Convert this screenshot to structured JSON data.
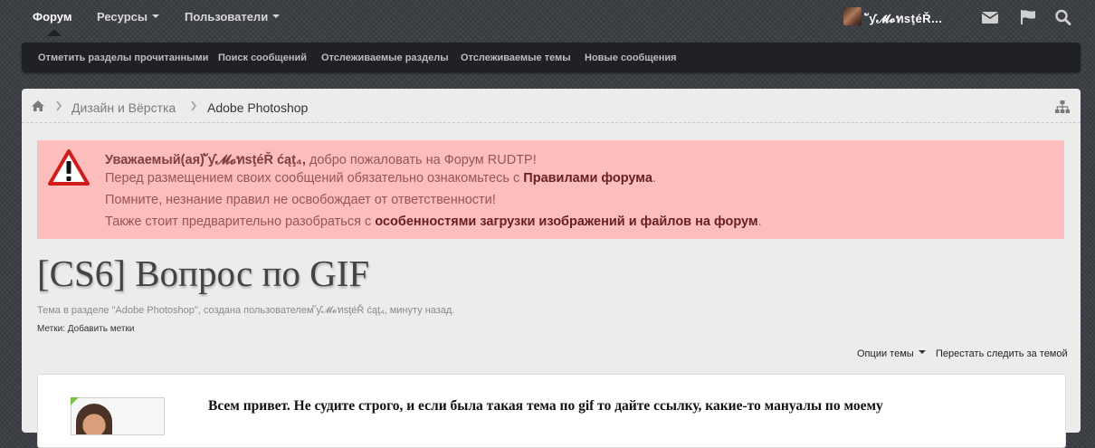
{
  "nav": {
    "tabs": [
      {
        "label": "Форум",
        "active": true
      },
      {
        "label": "Ресурсы",
        "dropdown": true
      },
      {
        "label": "Пользователи",
        "dropdown": true
      }
    ],
    "user_name": "ัƴ𝓜𝓸ทѕţéŘ...",
    "icons": [
      "envelope-icon",
      "flag-icon",
      "search-icon"
    ]
  },
  "subnav": {
    "items": [
      "Отметить разделы прочитанными",
      "Поиск сообщений",
      "Отслеживаемые разделы",
      "Отслеживаемые темы",
      "Новые сообщения"
    ]
  },
  "breadcrumb": {
    "icon": "home-icon",
    "items": [
      "Дизайн и Вёрстка",
      "Adobe Photoshop"
    ]
  },
  "notice": {
    "greeting_prefix": "Уважаемый(ая)",
    "greeting_name": "ัƴ𝓜𝓸ทѕţéŘ ćąţ₄,",
    "greeting_suffix": "добро пожаловать на Форум RUDTP!",
    "line2_prefix": "Перед размещением своих сообщений обязательно ознакомьтесь с",
    "line2_link": "Правилами форума",
    "line2_suffix": ".",
    "line3": "Помните, незнание правил не освобождает от ответственности!",
    "line4_prefix": "Также стоит предварительно разобраться с",
    "line4_link": "особенностями загрузки изображений и файлов на форум",
    "line4_suffix": "."
  },
  "thread": {
    "title": "[CS6] Вопрос по GIF",
    "meta": "Тема в разделе \"Adobe Photoshop\", создана пользователем ัƴ𝓜𝓸ทѕţéŘ ćąţ₄, минуту назад.",
    "tags_label": "Метки:",
    "tags_link": "Добавить метки",
    "options_label": "Опции темы",
    "unwatch_label": "Перестать следить за темой"
  },
  "post": {
    "text": "Всем привет. Не судите строго, и если была такая тема по gif то дайте ссылку, какие-то мануалы по моему"
  },
  "colors": {
    "notice_bg": "#fcbdbd",
    "notice_text": "#9a5454",
    "online_indicator": "#7bc043"
  }
}
